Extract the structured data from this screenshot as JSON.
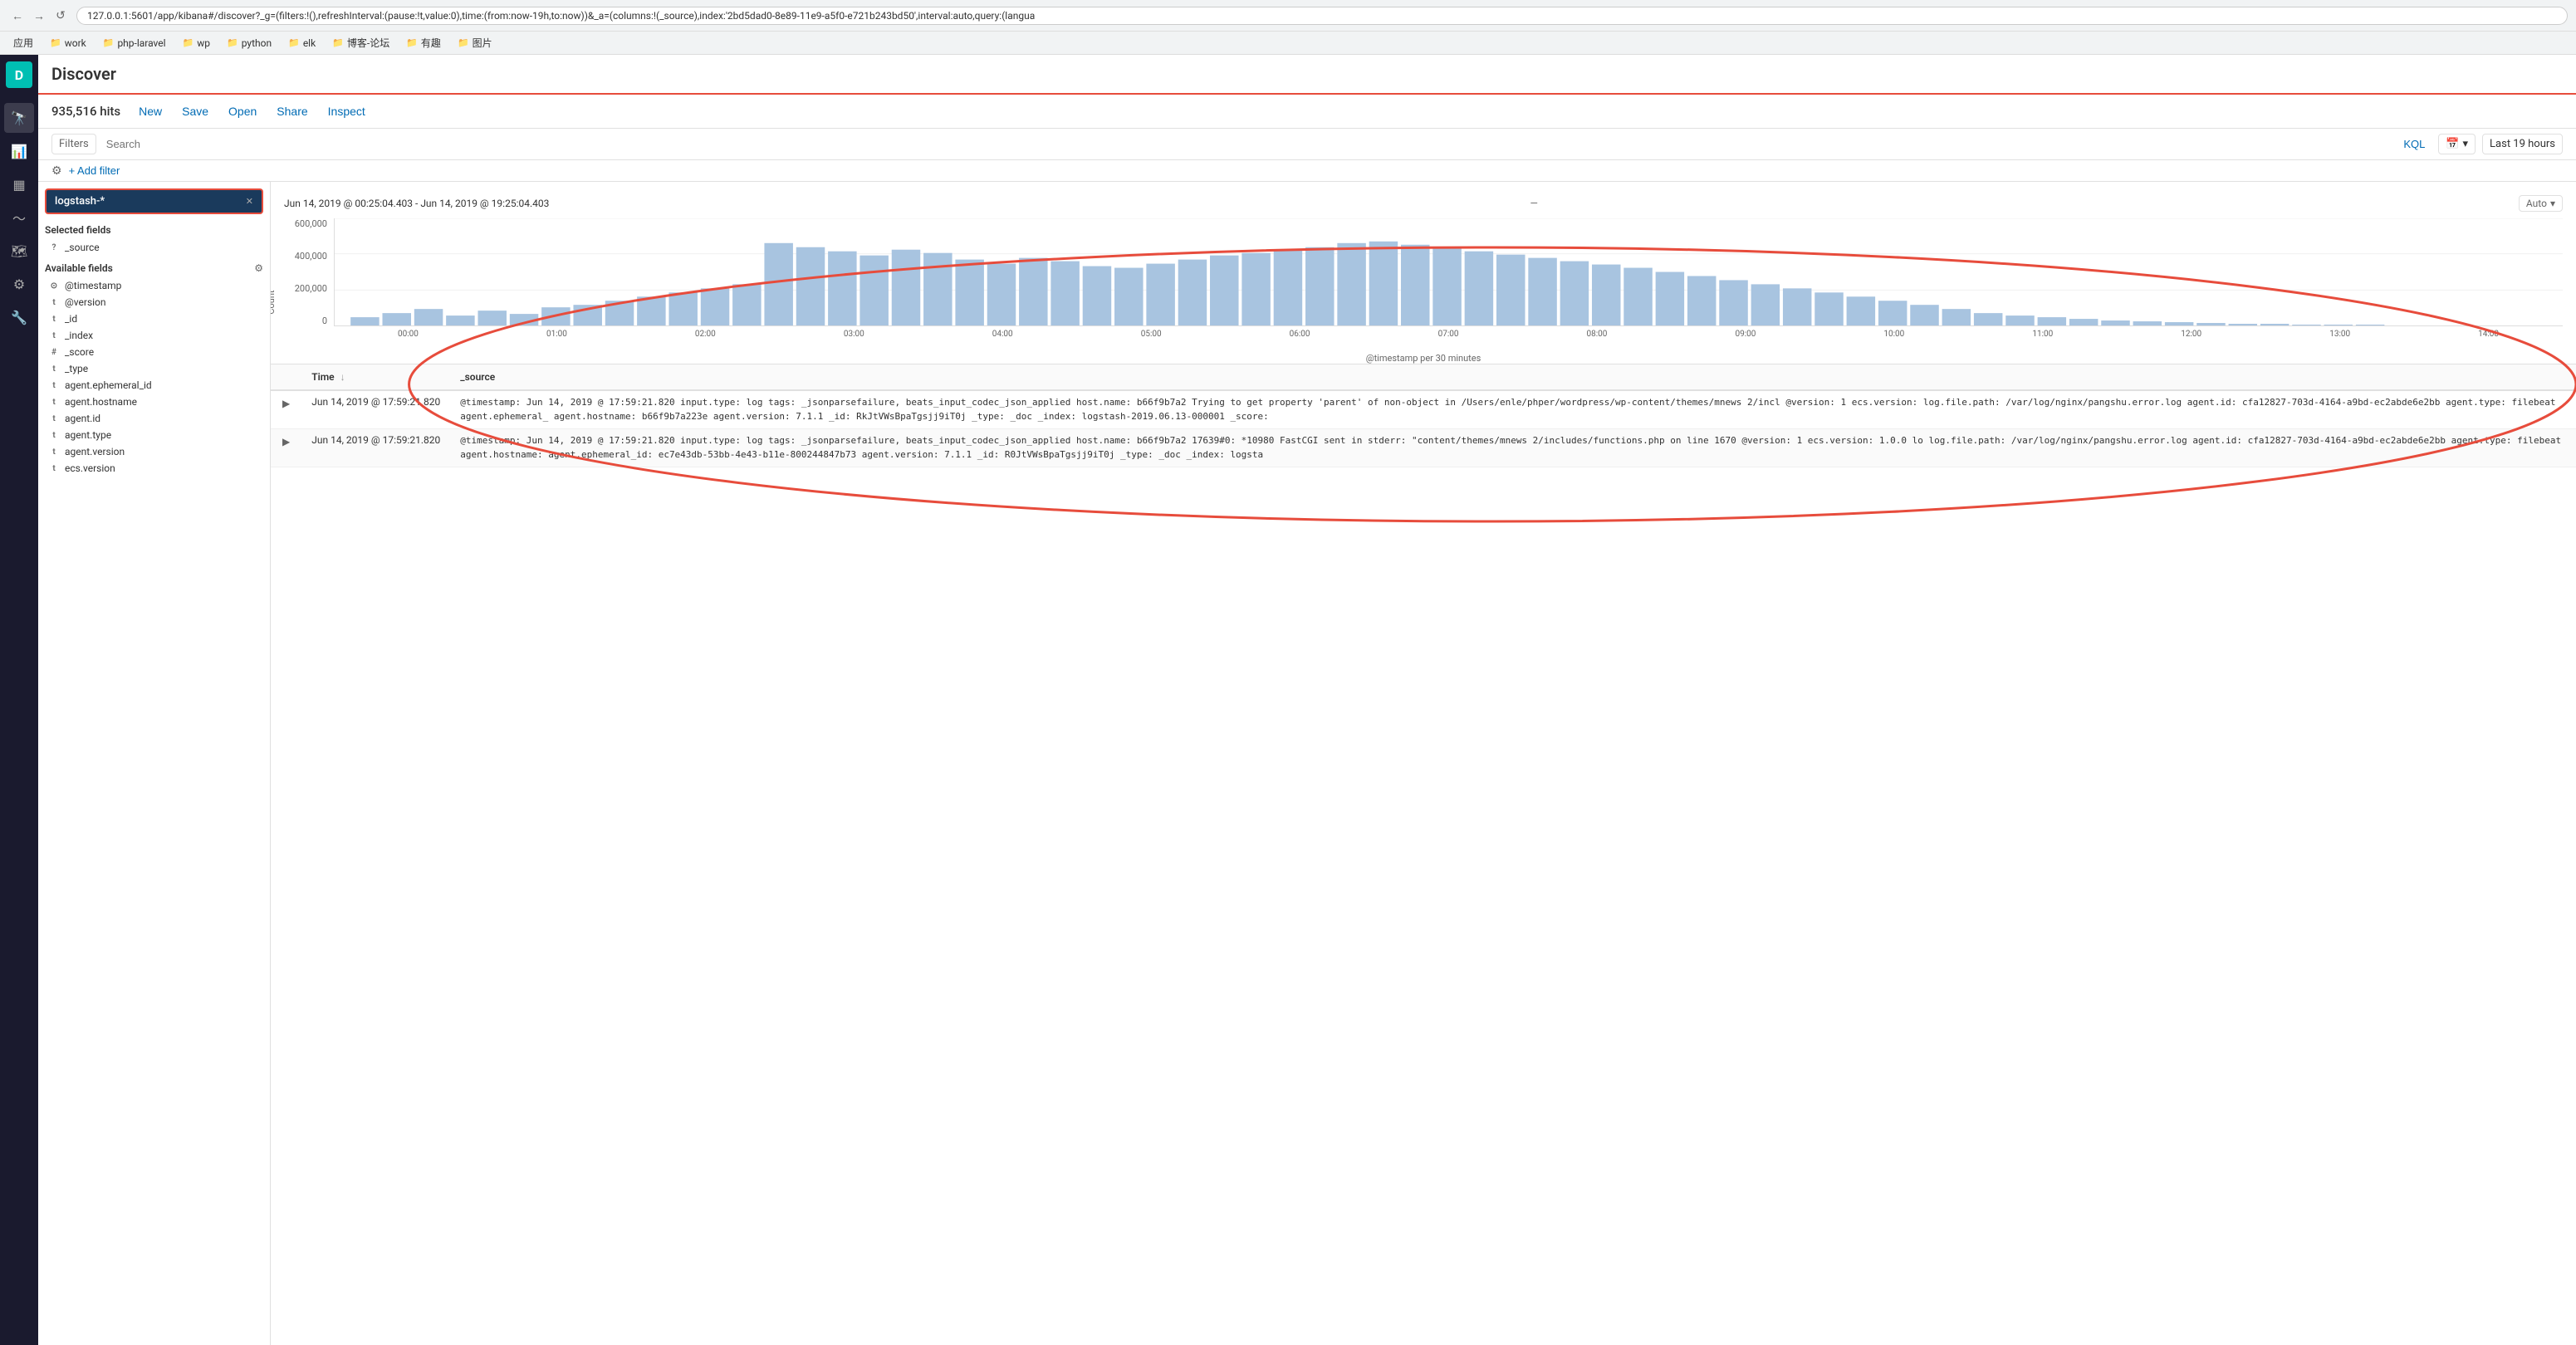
{
  "browser": {
    "url": "127.0.0.1:5601/app/kibana#/discover?_g=(filters:!(),refreshInterval:(pause:!t,value:0),time:(from:now-19h,to:now))&_a=(columns:!(_source),index:'2bd5dad0-8e89-11e9-a5f0-e721b243bd50',interval:auto,query:(langua",
    "back_label": "←",
    "forward_label": "→",
    "refresh_label": "↺"
  },
  "bookmarks": [
    {
      "label": "应用",
      "type": "text"
    },
    {
      "label": "work",
      "type": "folder"
    },
    {
      "label": "php-laravel",
      "type": "folder"
    },
    {
      "label": "wp",
      "type": "folder"
    },
    {
      "label": "python",
      "type": "folder"
    },
    {
      "label": "elk",
      "type": "folder"
    },
    {
      "label": "博客-论坛",
      "type": "folder"
    },
    {
      "label": "有趣",
      "type": "folder"
    },
    {
      "label": "图片",
      "type": "folder"
    }
  ],
  "kibana": {
    "logo": "D",
    "page_title": "Discover",
    "hits_count": "935,516 hits"
  },
  "toolbar": {
    "new_label": "New",
    "save_label": "Save",
    "open_label": "Open",
    "share_label": "Share",
    "inspect_label": "Inspect"
  },
  "filter_bar": {
    "filters_label": "Filters",
    "search_placeholder": "Search",
    "kql_label": "KQL",
    "time_range_label": "Last 19 hours",
    "add_filter_label": "+ Add filter"
  },
  "index_pattern": "logstash-*",
  "selected_fields": {
    "title": "Selected fields",
    "items": [
      {
        "type": "?",
        "name": "_source"
      }
    ]
  },
  "available_fields": {
    "title": "Available fields",
    "items": [
      {
        "type": "⊙",
        "name": "@timestamp"
      },
      {
        "type": "t",
        "name": "@version"
      },
      {
        "type": "t",
        "name": "_id"
      },
      {
        "type": "t",
        "name": "_index"
      },
      {
        "type": "#",
        "name": "_score"
      },
      {
        "type": "t",
        "name": "_type"
      },
      {
        "type": "t",
        "name": "agent.ephemeral_id"
      },
      {
        "type": "t",
        "name": "agent.hostname"
      },
      {
        "type": "t",
        "name": "agent.id"
      },
      {
        "type": "t",
        "name": "agent.type"
      },
      {
        "type": "t",
        "name": "agent.version"
      },
      {
        "type": "t",
        "name": "ecs.version"
      }
    ]
  },
  "chart": {
    "time_range": "Jun 14, 2019 @ 00:25:04.403 - Jun 14, 2019 @ 19:25:04.403",
    "interval_label": "Auto",
    "y_axis": [
      "600,000",
      "400,000",
      "200,000",
      "0"
    ],
    "x_axis": [
      "00:00",
      "01:00",
      "02:00",
      "03:00",
      "04:00",
      "05:00",
      "06:00",
      "07:00",
      "08:00",
      "09:00",
      "10:00",
      "11:00",
      "12:00",
      "13:00",
      "14:00"
    ],
    "x_label": "@timestamp per 30 minutes",
    "count_label": "Count"
  },
  "results": {
    "col_time": "Time",
    "col_source": "_source",
    "rows": [
      {
        "time": "Jun 14, 2019 @ 17:59:21.820",
        "source": "@timestamp: Jun 14, 2019 @ 17:59:21.820  input.type: log  tags: _jsonparsefailure, beats_input_codec_json_applied  host.name: b66f9b7a2  Trying to get property 'parent' of non-object in /Users/enle/phper/wordpress/wp-content/themes/mnews 2/incl  @version: 1  ecs.version:  log.file.path: /var/log/nginx/pangshu.error.log  agent.id: cfa12827-703d-4164-a9bd-ec2abde6e2bb  agent.type: filebeat  agent.ephemeral_  agent.hostname: b66f9b7a223e  agent.version: 7.1.1  _id: RkJtVWsBpaTgsjj9iT0j  _type: _doc  _index: logstash-2019.06.13-000001  _score:"
      },
      {
        "time": "Jun 14, 2019 @ 17:59:21.820",
        "source": "@timestamp: Jun 14, 2019 @ 17:59:21.820  input.type: log  tags: _jsonparsefailure, beats_input_codec_json_applied  host.name: b66f9b7a2  17639#0: *10980 FastCGI sent in stderr: \"content/themes/mnews 2/includes/functions.php on line 1670  @version: 1  ecs.version: 1.0.0  lo  log.file.path: /var/log/nginx/pangshu.error.log  agent.id: cfa12827-703d-4164-a9bd-ec2abde6e2bb  agent.type: filebeat  agent.hostname:  agent.ephemeral_id: ec7e43db-53bb-4e43-b11e-800244847b73  agent.version: 7.1.1  _id: R0JtVWsBpaTgsjj9iT0j  _type: _doc  _index: logsta"
      }
    ]
  },
  "nav_icons": [
    {
      "icon": "≡",
      "name": "menu-icon"
    },
    {
      "icon": "🔍",
      "name": "discover-icon"
    },
    {
      "icon": "📊",
      "name": "visualize-icon"
    },
    {
      "icon": "📋",
      "name": "dashboard-icon"
    },
    {
      "icon": "🗂",
      "name": "timelion-icon"
    },
    {
      "icon": "🔧",
      "name": "dev-tools-icon"
    },
    {
      "icon": "⚙",
      "name": "management-icon"
    }
  ]
}
